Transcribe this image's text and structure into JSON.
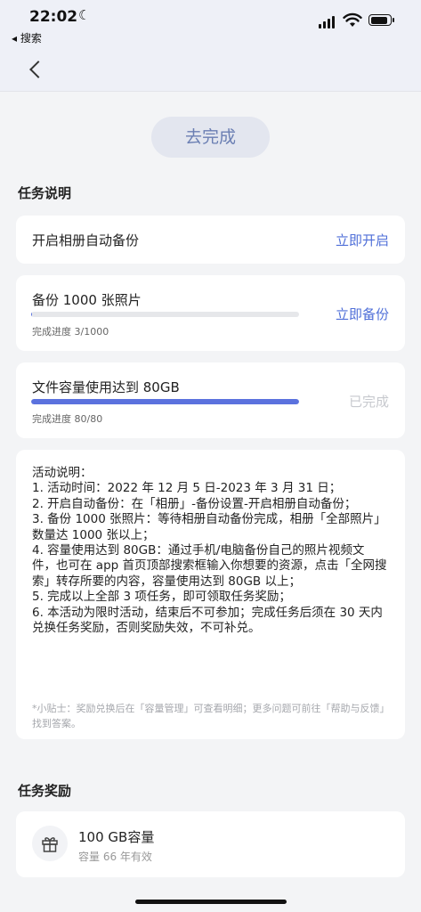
{
  "status_bar": {
    "time": "22:02",
    "moon_glyph": "☾",
    "back_app": "◂ 搜索"
  },
  "primary_button": "去完成",
  "tasks_section_title": "任务说明",
  "tasks": [
    {
      "title": "开启相册自动备份",
      "action": "立即开启"
    },
    {
      "title": "备份 1000 张照片",
      "action": "立即备份",
      "progress_text": "完成进度 3/1000",
      "progress": 0.003
    },
    {
      "title": "文件容量使用达到 80GB",
      "action": "已完成",
      "progress_text": "完成进度 80/80",
      "progress": 1.0
    }
  ],
  "description": {
    "lines": [
      "活动说明：",
      "1. 活动时间：2022 年 12 月 5 日-2023 年 3 月 31 日；",
      "2. 开启自动备份：在「相册」-备份设置-开启相册自动备份；",
      "3. 备份 1000 张照片：等待相册自动备份完成，相册「全部照片」数量达 1000 张以上；",
      "4. 容量使用达到 80GB：通过手机/电脑备份自己的照片视频文件，也可在 app 首页顶部搜索框输入你想要的资源，点击「全网搜索」转存所要的内容，容量使用达到 80GB 以上；",
      "5. 完成以上全部 3 项任务，即可领取任务奖励；",
      "6. 本活动为限时活动，结束后不可参加；完成任务后须在 30 天内兑换任务奖励，否则奖励失效，不可补兑。"
    ],
    "tip": "*小贴士：奖励兑换后在「容量管理」可查看明细；更多问题可前往「帮助与反馈」找到答案。"
  },
  "rewards_section_title": "任务奖励",
  "reward": {
    "title": "100 GB容量",
    "subtitle": "容量 66 年有效",
    "icon": "gift-icon"
  },
  "colors": {
    "accent": "#4f6fd8",
    "progress": "#5b72de",
    "done": "#c7c9ce",
    "button_text": "#6b7fb3"
  }
}
